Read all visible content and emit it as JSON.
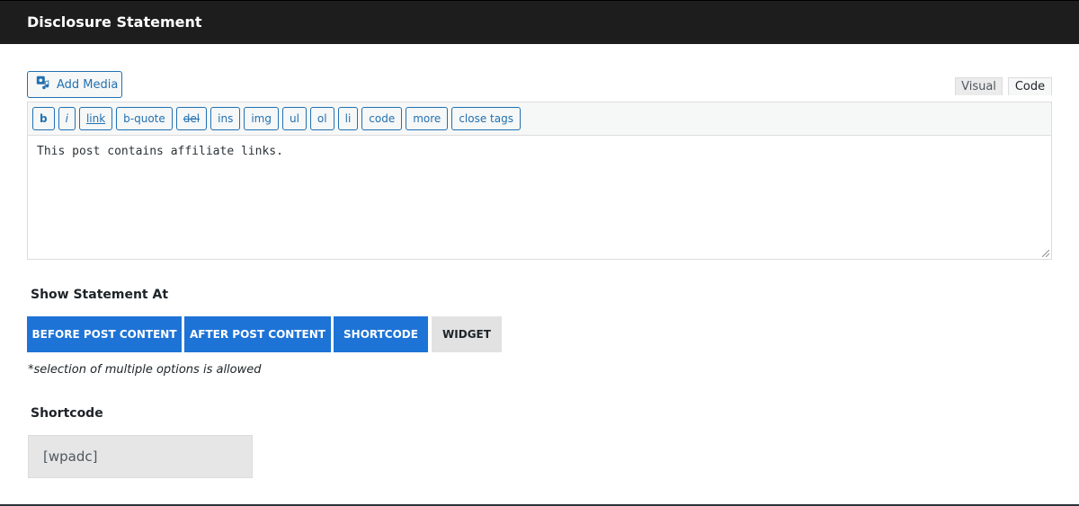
{
  "header": {
    "title": "Disclosure Statement"
  },
  "editor": {
    "add_media_label": "Add Media",
    "tabs": {
      "visual": "Visual",
      "code": "Code"
    },
    "quicktags": [
      "b",
      "i",
      "link",
      "b-quote",
      "del",
      "ins",
      "img",
      "ul",
      "ol",
      "li",
      "code",
      "more",
      "close tags"
    ],
    "content": "This post contains affiliate links."
  },
  "show_at": {
    "label": "Show Statement At",
    "options": [
      "BEFORE POST CONTENT",
      "AFTER POST CONTENT",
      "SHORTCODE",
      "WIDGET"
    ],
    "note": "*selection of multiple options is allowed"
  },
  "shortcode": {
    "label": "Shortcode",
    "value": "[wpadc]"
  },
  "colors": {
    "header_bg": "#1d1d1d",
    "accent": "#1e73d6",
    "link_blue": "#2271b1",
    "inactive_bg": "#e2e2e2"
  }
}
